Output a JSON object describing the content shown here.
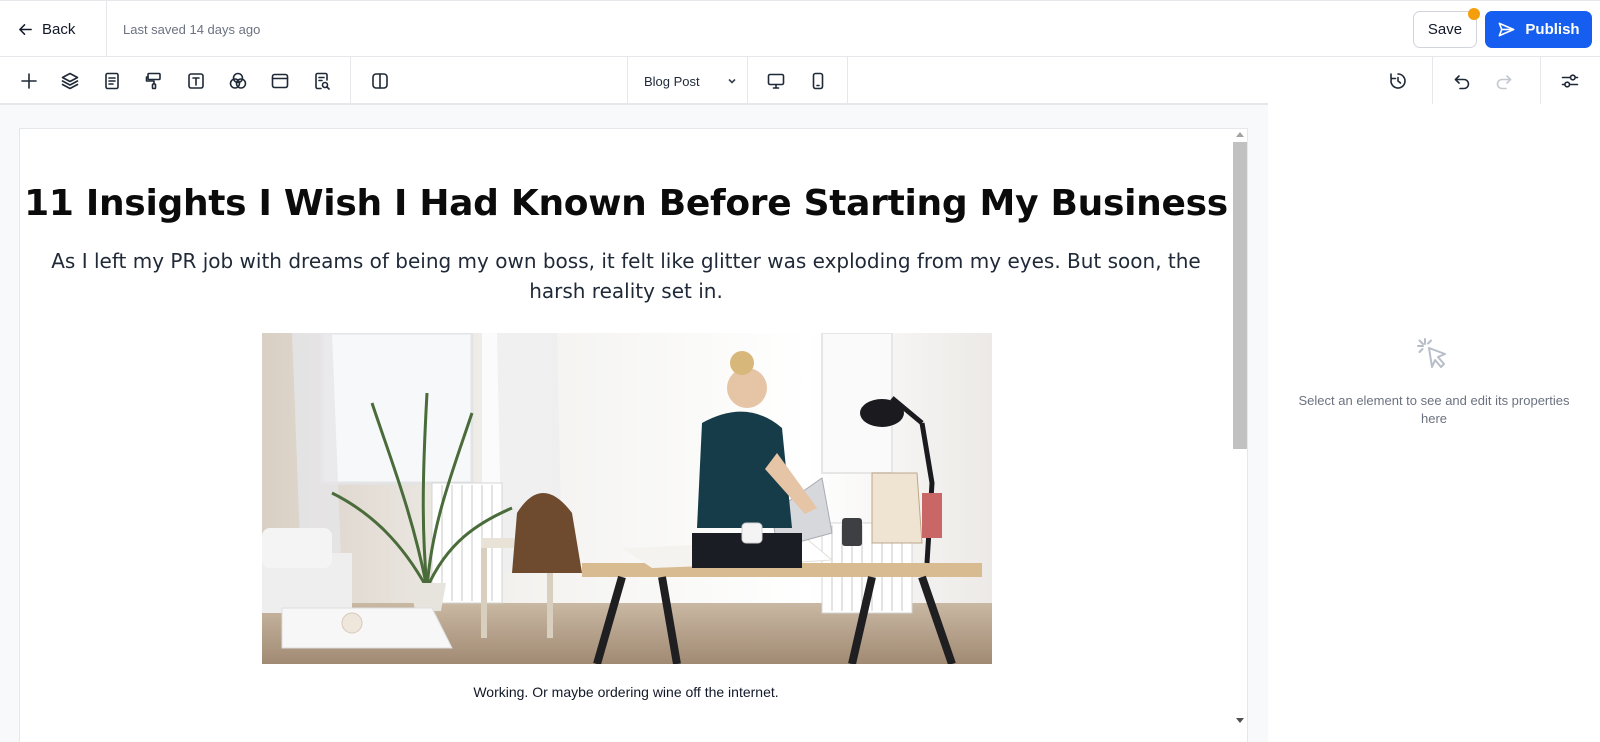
{
  "header": {
    "back_label": "Back",
    "last_saved": "Last saved 14 days ago",
    "save_label": "Save",
    "publish_label": "Publish",
    "accent_color": "#155eef",
    "unsaved_indicator_color": "#f59e0b"
  },
  "toolbar": {
    "left_tools": [
      {
        "icon": "plus-icon",
        "title": "Add element"
      },
      {
        "icon": "layers-icon",
        "title": "Layers"
      },
      {
        "icon": "pages-icon",
        "title": "Pages"
      },
      {
        "icon": "paint-roller-icon",
        "title": "Styles"
      },
      {
        "icon": "text-icon",
        "title": "Typography"
      },
      {
        "icon": "color-circles-icon",
        "title": "Colors"
      },
      {
        "icon": "browser-window-icon",
        "title": "Sections"
      },
      {
        "icon": "document-search-icon",
        "title": "SEO"
      }
    ],
    "split_view_icon": "split-view-icon",
    "page_select": {
      "value": "Blog Post"
    },
    "device_icons": [
      "desktop-icon",
      "mobile-icon"
    ],
    "right_tools": [
      "history-icon",
      "undo-icon",
      "redo-icon",
      "settings-sliders-icon"
    ]
  },
  "post": {
    "title": "11 Insights I Wish I Had Known Before Starting My Business",
    "intro": "As I left my PR job with dreams of being my own boss, it felt like glitter was exploding from my eyes. But soon, the harsh reality set in.",
    "image_alt": "woman-working-at-desk-photo",
    "caption": "Working. Or maybe ordering wine off the internet."
  },
  "properties_panel": {
    "icon": "cursor-click-icon",
    "empty_message": "Select an element to see and edit its properties here"
  }
}
